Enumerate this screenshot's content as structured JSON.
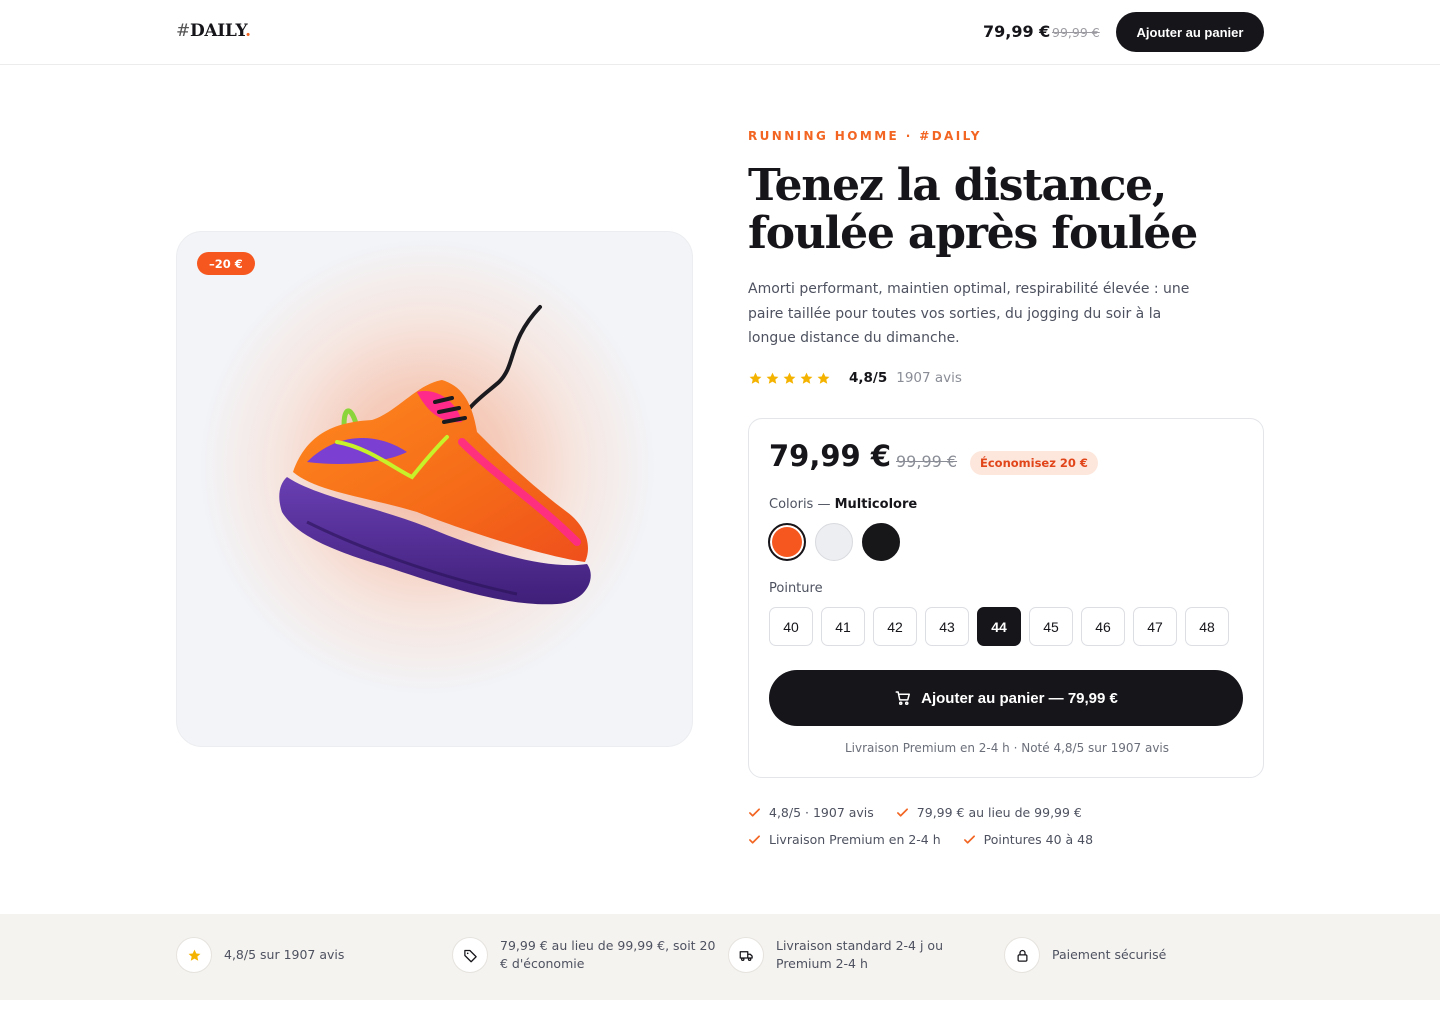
{
  "header": {
    "logo_hash": "#",
    "logo_text": "DAILY",
    "logo_dot": ".",
    "price": "79,99 €",
    "old_price": "99,99 €",
    "cart_button": "Ajouter au panier"
  },
  "product": {
    "discount_badge": "–20 €",
    "eyebrow": "RUNNING HOMME · #DAILY",
    "title_line1": "Tenez la distance,",
    "title_line2": "foulée après foulée",
    "description": "Amorti performant, maintien optimal, respirabilité élevée : une paire taillée pour toutes vos sorties, du jogging du soir à la longue distance du dimanche.",
    "stars": 5,
    "rating": "4,8/5",
    "reviews": "1907 avis"
  },
  "buybox": {
    "price": "79,99 €",
    "old_price": "99,99 €",
    "savings": "Économisez 20 €",
    "color_label": "Coloris —",
    "color_selected": "Multicolore",
    "colors": [
      {
        "name": "orange",
        "hex": "#f5571f"
      },
      {
        "name": "white",
        "hex": "#eceef1"
      },
      {
        "name": "black",
        "hex": "#17171a"
      }
    ],
    "size_label": "Pointure",
    "sizes": [
      "40",
      "41",
      "42",
      "43",
      "44",
      "45",
      "46",
      "47",
      "48"
    ],
    "selected_size": "44",
    "cta": "Ajouter au panier — 79,99 €",
    "note": "Livraison Premium en 2-4 h · Noté 4,8/5 sur 1907 avis"
  },
  "checks": [
    "4,8/5 · 1907 avis",
    "79,99 € au lieu de 99,99 €",
    "Livraison Premium en 2-4 h",
    "Pointures 40 à 48"
  ],
  "features": [
    {
      "icon": "star-icon",
      "text": "4,8/5 sur 1907 avis"
    },
    {
      "icon": "tag-icon",
      "text": "79,99 € au lieu de 99,99 €, soit 20 € d'économie"
    },
    {
      "icon": "truck-icon",
      "text": "Livraison standard 2-4 j ou Premium 2-4 h"
    },
    {
      "icon": "lock-icon",
      "text": "Paiement sécurisé"
    }
  ],
  "colors": {
    "accent": "#f26522",
    "dark": "#15151a",
    "star": "#f5b301"
  }
}
